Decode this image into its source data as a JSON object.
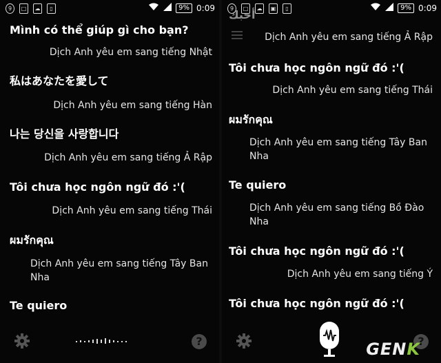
{
  "status_bar": {
    "time": "0:09",
    "battery": "9%"
  },
  "left_panel": {
    "messages": [
      {
        "role": "user",
        "text": "Mình có thể giúp gì cho bạn?"
      },
      {
        "role": "assistant",
        "text": "Dịch Anh yêu em sang tiếng Nhật"
      },
      {
        "role": "user",
        "text": "私はあなたを愛して"
      },
      {
        "role": "assistant",
        "text": "Dịch Anh yêu em sang tiếng Hàn"
      },
      {
        "role": "user",
        "text": "나는 당신을 사랑합니다"
      },
      {
        "role": "assistant",
        "text": "Dịch Anh yêu em sang tiếng Ả Rập"
      },
      {
        "role": "user",
        "text": "Tôi chưa học ngôn ngữ đó :'("
      },
      {
        "role": "assistant",
        "text": "Dịch Anh yêu em sang tiếng Thái"
      },
      {
        "role": "user",
        "text": "ผมรักคุณ"
      },
      {
        "role": "assistant",
        "text": "Dịch Anh yêu em sang tiếng Tây Ban Nha"
      },
      {
        "role": "user",
        "text": "Te quiero"
      }
    ]
  },
  "right_panel": {
    "messages": [
      {
        "role": "user",
        "text": "أحبك"
      },
      {
        "role": "assistant",
        "text": "Dịch Anh yêu em sang tiếng Ả Rập"
      },
      {
        "role": "user",
        "text": "Tôi chưa học ngôn ngữ đó :'("
      },
      {
        "role": "assistant",
        "text": "Dịch Anh yêu em sang tiếng Thái"
      },
      {
        "role": "user",
        "text": "ผมรักคุณ"
      },
      {
        "role": "assistant",
        "text": "Dịch Anh yêu em sang tiếng Tây Ban Nha"
      },
      {
        "role": "user",
        "text": "Te quiero"
      },
      {
        "role": "assistant",
        "text": "Dịch Anh yêu em sang tiếng Bồ Đào Nha"
      },
      {
        "role": "user",
        "text": "Tôi chưa học ngôn ngữ đó :'("
      },
      {
        "role": "assistant",
        "text": "Dịch Anh yêu em sang tiếng Ý"
      },
      {
        "role": "user",
        "text": "Tôi chưa học ngôn ngữ đó :'("
      }
    ]
  },
  "icons": {
    "settings": "gear-icon",
    "help": "help-icon",
    "mic": "microphone-icon",
    "menu": "hamburger-icon",
    "help_glyph": "?"
  },
  "watermark": {
    "text_main": "GEN",
    "text_accent": "K",
    "accent_color": "#8dc63f"
  }
}
